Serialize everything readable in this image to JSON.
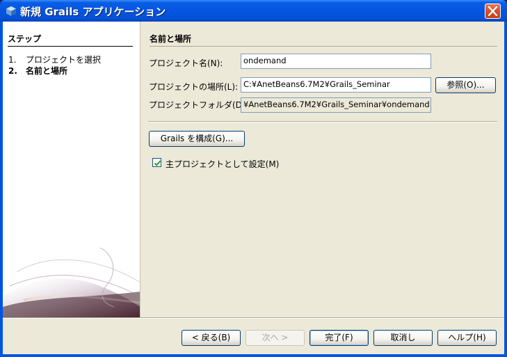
{
  "window": {
    "title": "新規 Grails アプリケーション"
  },
  "steps": {
    "header": "ステップ",
    "items": [
      {
        "num": "1.",
        "label": "プロジェクトを選択"
      },
      {
        "num": "2.",
        "label": "名前と場所"
      }
    ]
  },
  "main": {
    "section_title": "名前と場所",
    "project_name_label": "プロジェクト名(N):",
    "project_name_value": "ondemand",
    "project_location_label": "プロジェクトの場所(L):",
    "project_location_value": "C:¥AnetBeans6.7M2¥Grails_Seminar",
    "browse_label": "参照(O)...",
    "project_folder_label": "プロジェクトフォルダ(D):",
    "project_folder_value": "¥AnetBeans6.7M2¥Grails_Seminar¥ondemand",
    "configure_grails_label": "Grails を構成(G)...",
    "main_project_label": "主プロジェクトとして設定(M)",
    "main_project_checked": true
  },
  "footer": {
    "back_label": "< 戻る(B)",
    "next_label": "次へ >",
    "finish_label": "完了(F)",
    "cancel_label": "取消し",
    "help_label": "ヘルプ(H)"
  }
}
